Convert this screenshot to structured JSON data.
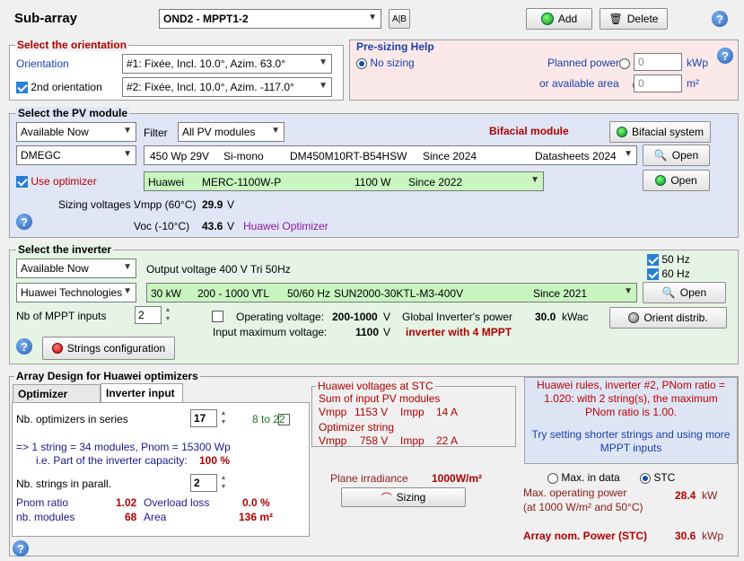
{
  "header": {
    "title": "Sub-array",
    "subarray": "OND2 - MPPT1-2",
    "add": "Add",
    "delete": "Delete"
  },
  "orientation": {
    "legend": "Select the orientation",
    "label1": "Orientation",
    "value1": "#1: Fixée, Incl. 10.0°, Azim. 63.0°",
    "label2": "2nd orientation",
    "value2": "#2: Fixée, Incl. 10.0°, Azim. -117.0°"
  },
  "presizing": {
    "legend": "Pre-sizing Help",
    "no_sizing": "No sizing",
    "planned_power": "Planned power",
    "power_value": "0",
    "power_unit": "kWp",
    "avail_area": "or available area",
    "area_value": "0",
    "area_unit": "m²"
  },
  "pvmodule": {
    "legend": "Select the PV module",
    "availability": "Available Now",
    "filter_label": "Filter",
    "filter": "All PV modules",
    "bifacial": "Bifacial module",
    "bifacial_btn": "Bifacial system",
    "manufacturer": "DMEGC",
    "module": {
      "power": "450 Wp 29V",
      "tech": "Si-mono",
      "model": "DM450M10RT-B54HSW",
      "since": "Since 2024",
      "source": "Datasheets 2024"
    },
    "open": "Open",
    "use_optimizer": "Use optimizer",
    "optimizer": {
      "brand": "Huawei",
      "model": "MERC-1100W-P",
      "power": "1100 W",
      "since": "Since 2022"
    },
    "open2": "Open",
    "sizing_label": "Sizing voltages :",
    "vmpp_label": "Vmpp (60°C)",
    "vmpp_value": "29.9",
    "voc_label": "Voc (-10°C)",
    "voc_value": "43.6",
    "unit_v": "V",
    "opt_name": "Huawei Optimizer"
  },
  "inverter": {
    "legend": "Select the inverter",
    "availability": "Available Now",
    "output": "Output voltage 400 V Tri 50Hz",
    "hz50": "50 Hz",
    "hz60": "60 Hz",
    "manufacturer": "Huawei Technologies",
    "model": {
      "power": "30 kW",
      "range": "200 - 1000 V",
      "type": "TL",
      "freq": "50/60 Hz",
      "name": "SUN2000-30KTL-M3-400V",
      "since": "Since 2021"
    },
    "open": "Open",
    "mppt_label": "Nb of MPPT inputs",
    "mppt_value": "2",
    "op_voltage_label": "Operating voltage:",
    "op_voltage": "200-1000",
    "max_voltage_label": "Input maximum voltage:",
    "max_voltage": "1100",
    "unit_v": "V",
    "global_power_label": "Global Inverter's power",
    "global_power": "30.0",
    "global_unit": "kWac",
    "with_mppt": "inverter with 4 MPPT",
    "orient_btn": "Orient distrib.",
    "strings_btn": "Strings configuration"
  },
  "design": {
    "legend": "Array Design for Huawei optimizers",
    "tab1": "Optimizer input",
    "tab2": "Inverter input",
    "nb_series_label": "Nb. optimizers in series",
    "nb_series": "17",
    "range": "8 to 22",
    "string_text": "=> 1 string = 34 modules, Pnom = 15300 Wp",
    "part_label": "i.e. Part of the inverter capacity:",
    "part_value": "100 %",
    "nb_parall_label": "Nb. strings in parall.",
    "nb_parall": "2",
    "pnom_label": "Pnom ratio",
    "pnom_value": "1.02",
    "overload_label": "Overload loss",
    "overload_value": "0.0 %",
    "nbmod_label": "nb. modules",
    "nbmod_value": "68",
    "area_label": "Area",
    "area_value": "136 m²"
  },
  "stc": {
    "legend": "Huawei voltages at STC",
    "sum_label": "Sum of input PV modules",
    "vmpp1": "Vmpp",
    "vmpp1_val": "1153 V",
    "impp1": "Impp",
    "impp1_val": "14 A",
    "opt_label": "Optimizer string",
    "vmpp2": "Vmpp",
    "vmpp2_val": "758 V",
    "impp2": "Impp",
    "impp2_val": "22 A"
  },
  "rules": {
    "text": "Huawei rules, inverter #2, PNom ratio = 1.020: with 2 string(s), the maximum PNom ratio is 1.00.",
    "advice": "Try setting shorter strings and using more MPPT inputs"
  },
  "irr": {
    "label": "Plane irradiance",
    "value": "1000W/m²",
    "sizing_btn": "Sizing"
  },
  "results": {
    "max_data": "Max. in data",
    "stc": "STC",
    "max_power_label": "Max. operating power",
    "max_power_sub": "(at 1000 W/m² and 50°C)",
    "max_power": "28.4",
    "max_power_unit": "kW",
    "array_label": "Array nom. Power (STC)",
    "array_power": "30.6",
    "array_unit": "kWp"
  }
}
